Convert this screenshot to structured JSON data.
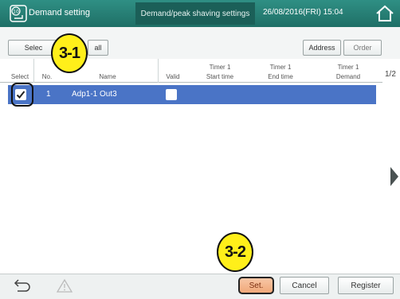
{
  "header": {
    "title": "Demand setting",
    "subtitle": "Demand/peak shaving settings",
    "datetime": "26/08/2016(FRI) 15:04",
    "icon": "demand-setting-icon",
    "home_icon": "home-icon"
  },
  "toolbar": {
    "select_all_label_left": "Selec",
    "select_all_label_right": "all",
    "address_label": "Address",
    "order_label": "Order"
  },
  "table": {
    "columns": [
      "Select",
      "No.",
      "Name",
      "Valid",
      "Timer 1",
      "Start time",
      "Timer 1",
      "End time",
      "Timer 1",
      "Demand"
    ],
    "rows": [
      {
        "no": "1",
        "name": "Adp1-1 Out3",
        "selected": true,
        "valid": false
      }
    ]
  },
  "page_indicator": "1/2",
  "bottom": {
    "set_label": "Set.",
    "cancel_label": "Cancel",
    "register_label": "Register",
    "back_icon": "back-arrow-icon",
    "warning_icon": "warning-icon"
  },
  "callouts": {
    "one": "3-1",
    "two": "3-2"
  },
  "colors": {
    "header": "#2f8f84",
    "selected_row": "#4a74c6",
    "set_button": "#f0a879",
    "callout": "#ffef1a"
  }
}
